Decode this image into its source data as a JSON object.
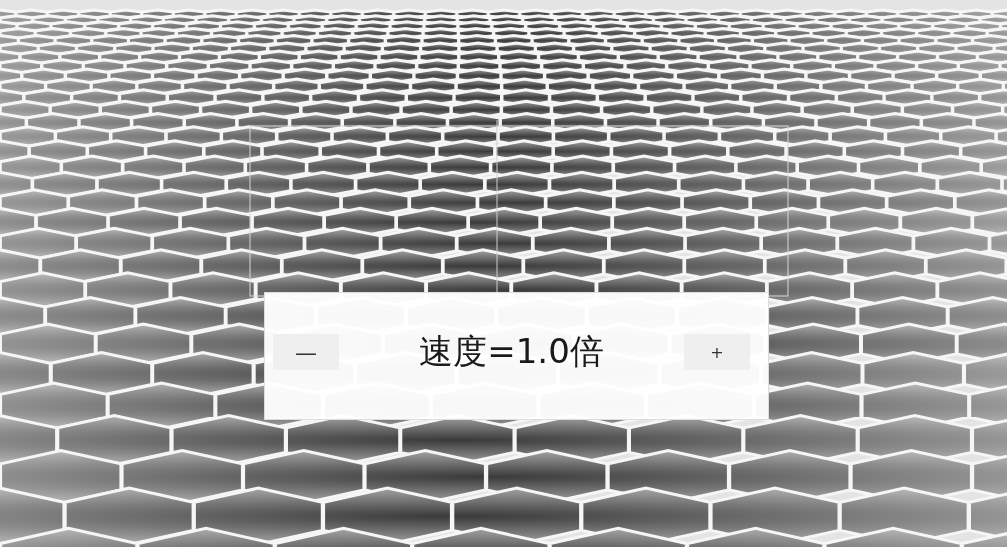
{
  "speed_panel": {
    "decrease_button": "—",
    "speed_label": "速度=1.0倍",
    "increase_button": "+"
  }
}
